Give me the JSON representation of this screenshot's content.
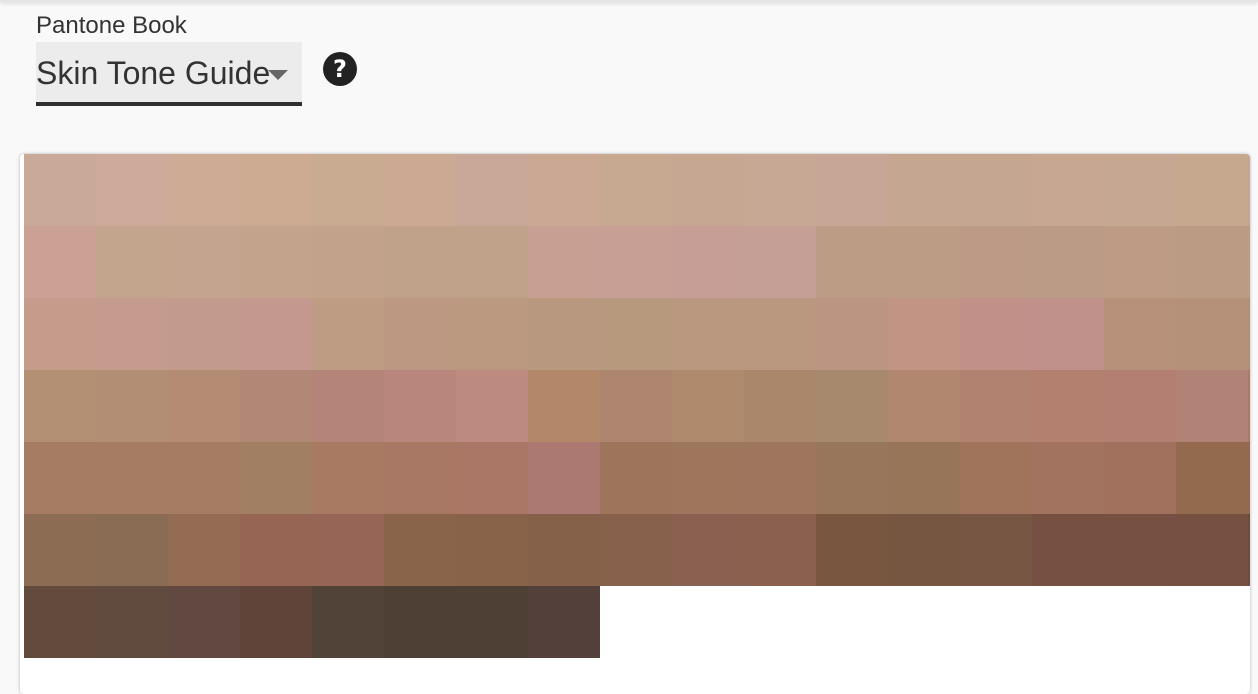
{
  "book": {
    "label": "Pantone Book",
    "selected": "Skin Tone Guide"
  },
  "icons": {
    "help": "help-circle-icon",
    "caret": "caret-down-icon"
  },
  "swatches": {
    "rows": [
      [
        "#c9a998",
        "#cdaa99",
        "#cdab95",
        "#ccab92",
        "#c8ab90",
        "#cba993",
        "#caa899",
        "#caa894",
        "#c7a991",
        "#c6a892",
        "#c7a894",
        "#c8a696",
        "#c5a690",
        "#c5a691",
        "#c7a791",
        "#c6a892",
        "#c6a88e",
        "#c4a595"
      ],
      [
        "#caa194",
        "#c3a48c",
        "#c4a38f",
        "#c3a38b",
        "#c2a28a",
        "#c0a28a",
        "#c0a189",
        "#c79f93",
        "#c79f94",
        "#c69e95",
        "#c59e96",
        "#bd9c86",
        "#bd9c86",
        "#bd9a86",
        "#bc9b86",
        "#bd9b85",
        "#bc9b85",
        "#bd9a88"
      ],
      [
        "#c59b8b",
        "#c49b8c",
        "#c39b8d",
        "#c4978f",
        "#be9c84",
        "#bc9882",
        "#ba9980",
        "#b89980",
        "#b7997e",
        "#b9987f",
        "#ba977f",
        "#bb9482",
        "#c19484",
        "#c19089",
        "#c0918b",
        "#b7917a",
        "#b6917a",
        "#b48f78"
      ],
      [
        "#b38f74",
        "#b18e74",
        "#b38c73",
        "#b18876",
        "#b48479",
        "#b9867d",
        "#bd8a82",
        "#b38869",
        "#ae8670",
        "#b08a6c",
        "#aa876b",
        "#a78a6d",
        "#b18770",
        "#b18270",
        "#b38070",
        "#b37f73",
        "#b18276",
        "#a87c63"
      ],
      [
        "#a67c62",
        "#a67c63",
        "#a57d62",
        "#a17f63",
        "#a77a61",
        "#a87864",
        "#aa7767",
        "#ab7971",
        "#9e755a",
        "#9e765c",
        "#9e755d",
        "#98765c",
        "#967558",
        "#a0735b",
        "#a2735f",
        "#a1715e",
        "#946a4f",
        "#956b4f"
      ],
      [
        "#8c6c52",
        "#8a6c54",
        "#946b53",
        "#966554",
        "#976556",
        "#89634a",
        "#89624a",
        "#86614a",
        "#87614b",
        "#8a6150",
        "#8c604f",
        "#785640",
        "#775641",
        "#775644",
        "#775044",
        "#775044",
        "#765142",
        "#684e3f"
      ],
      [
        "#624a3c",
        "#614a3e",
        "#614840",
        "#60443a",
        "#524338",
        "#4f4036",
        "#4f4036",
        "#53403a"
      ]
    ]
  }
}
